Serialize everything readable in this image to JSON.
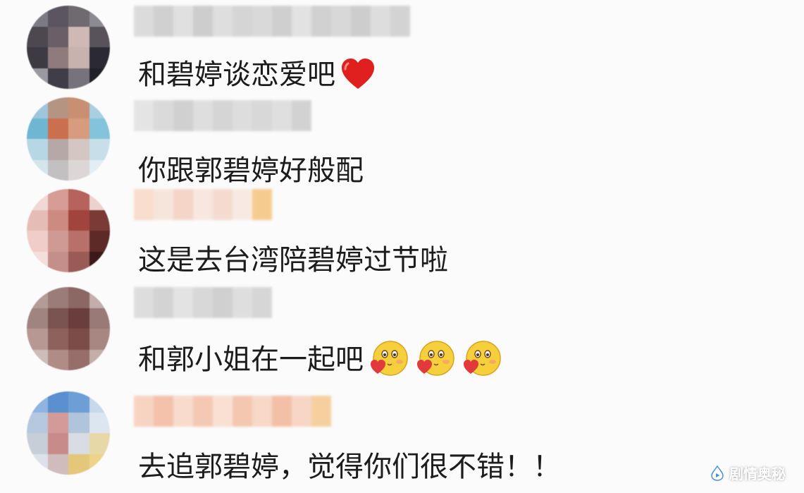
{
  "comments": [
    {
      "text": "和碧婷谈恋爱吧",
      "trail": "heart"
    },
    {
      "text": "你跟郭碧婷好般配",
      "trail": "none"
    },
    {
      "text": "这是去台湾陪碧婷过节啦",
      "trail": "none"
    },
    {
      "text": "和郭小姐在一起吧",
      "trail": "blush-emoji-x3"
    },
    {
      "text": "去追郭碧婷，觉得你们很不错！！",
      "trail": "none"
    }
  ],
  "watermark": {
    "label": "剧情奥秘",
    "icon": "play-drop-icon"
  },
  "colors": {
    "text": "#1c1c1c",
    "heart": "#e0201e",
    "background": "#fbfbfb"
  }
}
